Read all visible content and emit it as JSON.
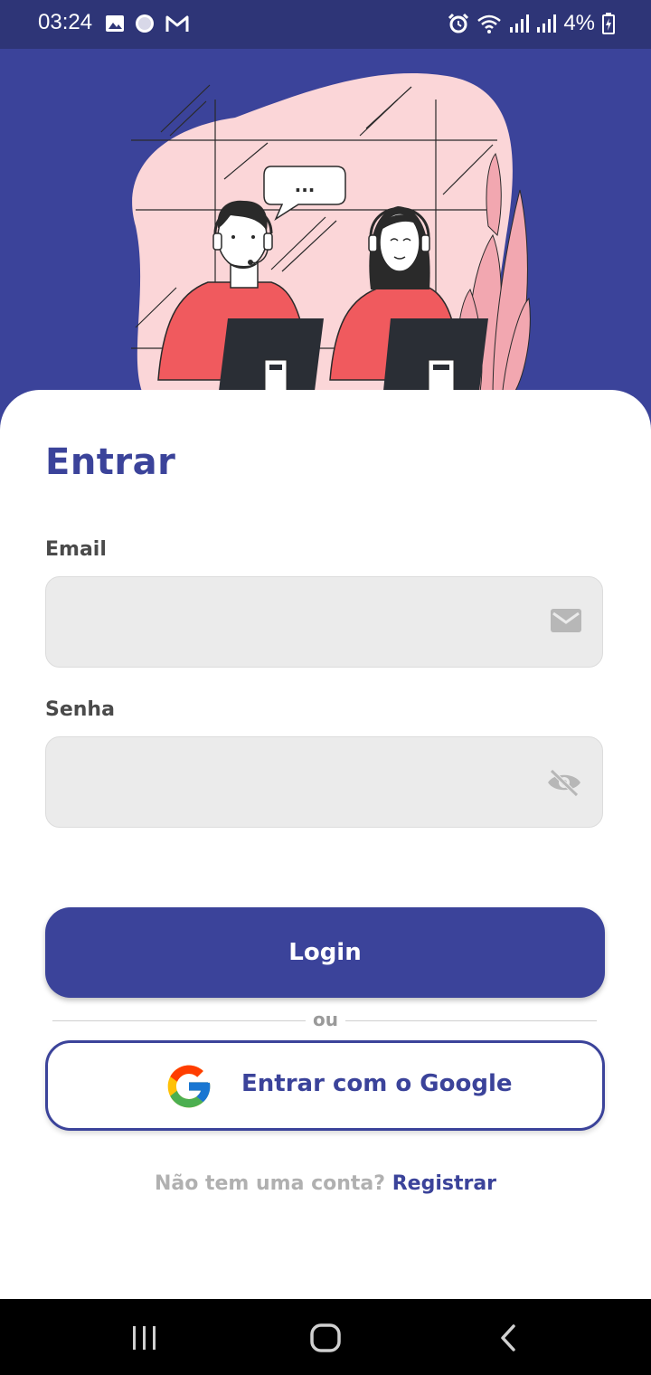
{
  "status_bar": {
    "time": "03:24",
    "battery": "4%",
    "left_icons": [
      "image-icon",
      "record-dot-icon",
      "gmail-icon"
    ],
    "right_icons": [
      "alarm-icon",
      "wifi-icon",
      "signal-icon",
      "signal-icon",
      "battery-charging-icon"
    ]
  },
  "hero": {
    "bubble_text": "...",
    "illustration": "call-center-agents-illustration"
  },
  "form": {
    "title": "Entrar",
    "email_label": "Email",
    "email_placeholder": "",
    "email_icon": "mail-icon",
    "password_label": "Senha",
    "password_placeholder": "",
    "password_icon": "eye-off-icon",
    "login_button": "Login",
    "divider_text": "ou",
    "google_button": "Entrar com o Google",
    "register_prompt": "Não tem uma conta?",
    "register_link": "Registrar"
  },
  "colors": {
    "primary": "#3b439a",
    "status_bar": "#2e3577",
    "input_bg": "#ebebeb",
    "blob_pink": "#fbd6d8",
    "shirt_red": "#f05a5e"
  },
  "nav_bar": {
    "buttons": [
      "recent-apps-icon",
      "home-icon",
      "back-icon"
    ]
  }
}
